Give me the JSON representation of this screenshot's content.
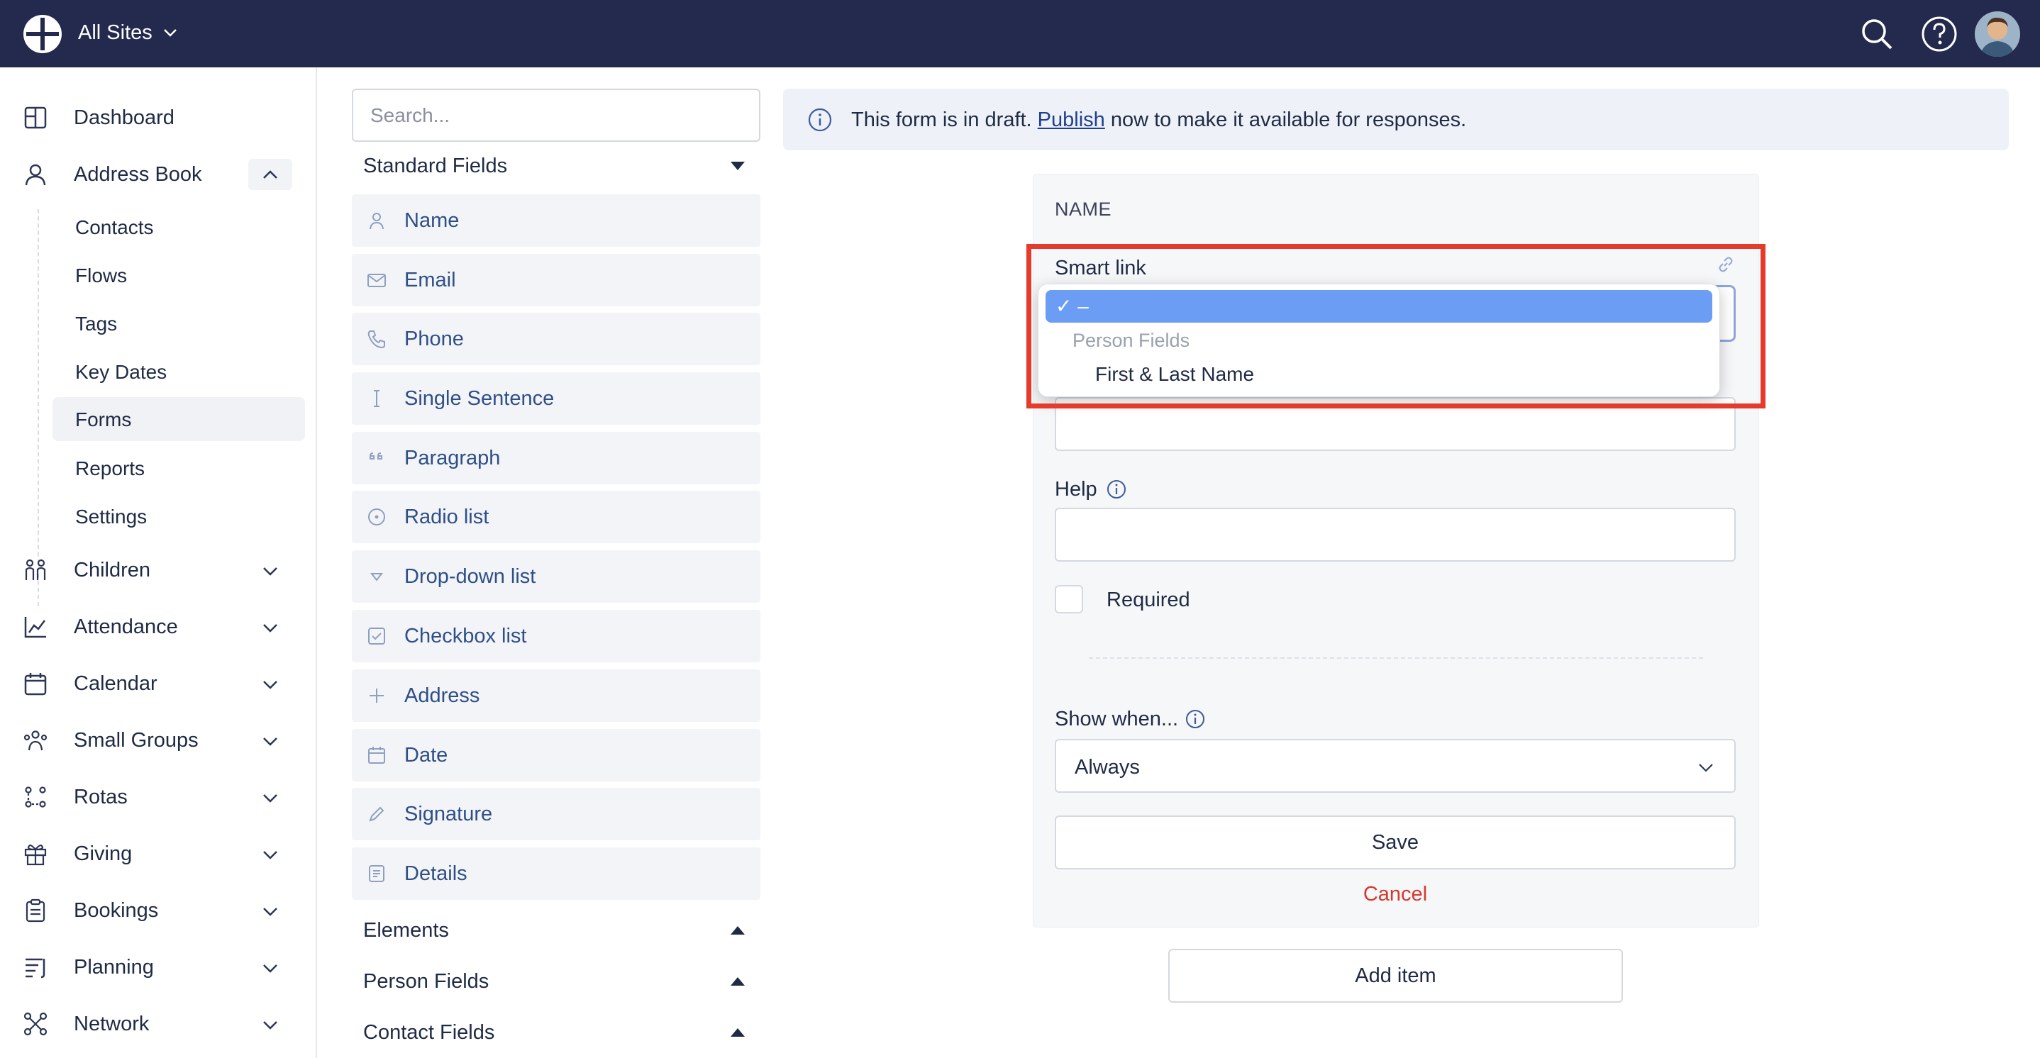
{
  "topbar": {
    "site_selector": "All Sites",
    "icons": [
      "logo-icon",
      "chevron-down-icon",
      "search-icon",
      "help-icon",
      "avatar"
    ]
  },
  "sidebar": {
    "items": [
      {
        "label": "Dashboard",
        "icon": "dashboard-icon"
      },
      {
        "label": "Address Book",
        "icon": "person-icon"
      },
      {
        "label": "Children",
        "icon": "children-icon"
      },
      {
        "label": "Attendance",
        "icon": "attendance-icon"
      },
      {
        "label": "Calendar",
        "icon": "calendar-icon"
      },
      {
        "label": "Small Groups",
        "icon": "groups-icon"
      },
      {
        "label": "Rotas",
        "icon": "rotas-icon"
      },
      {
        "label": "Giving",
        "icon": "gift-icon"
      },
      {
        "label": "Bookings",
        "icon": "clipboard-icon"
      },
      {
        "label": "Planning",
        "icon": "planning-icon"
      },
      {
        "label": "Network",
        "icon": "network-icon"
      }
    ],
    "address_book_sub": [
      "Contacts",
      "Flows",
      "Tags",
      "Key Dates",
      "Forms",
      "Reports",
      "Settings"
    ],
    "active_sub": "Forms"
  },
  "palette": {
    "search_placeholder": "Search...",
    "standard_heading": "Standard Fields",
    "fields": [
      "Name",
      "Email",
      "Phone",
      "Single Sentence",
      "Paragraph",
      "Radio list",
      "Drop-down list",
      "Checkbox list",
      "Address",
      "Date",
      "Signature",
      "Details"
    ],
    "elements_heading": "Elements",
    "person_fields_heading": "Person Fields",
    "contact_fields_heading": "Contact Fields"
  },
  "banner": {
    "text_before": "This form is in draft. ",
    "link": "Publish",
    "text_after": " now to make it available for responses."
  },
  "editor": {
    "title": "NAME",
    "smart_link_label": "Smart link",
    "dropdown": {
      "selected": "✓ –",
      "group": "Person Fields",
      "option": "First & Last Name"
    },
    "help_label": "Help",
    "required_label": "Required",
    "show_when_label": "Show when...",
    "show_when_value": "Always",
    "save_label": "Save",
    "cancel_label": "Cancel",
    "add_item_label": "Add item"
  },
  "colors": {
    "topbar": "#24294e",
    "highlight": "#e53b2c",
    "selected_option": "#6a9df3",
    "cancel": "#d6382e",
    "field_label": "#2f4f86"
  }
}
